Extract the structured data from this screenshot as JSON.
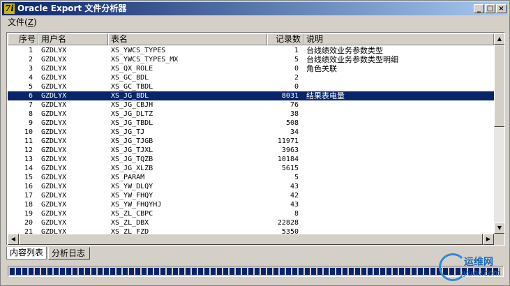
{
  "window": {
    "title": "Oracle Export 文件分析器",
    "icon": "app-icon",
    "icon_glyph": "7i",
    "buttons": [
      "minimize-icon",
      "maximize-icon",
      "close-icon"
    ],
    "button_glyphs": {
      "minimize": "_",
      "maximize": "□",
      "close": "×"
    }
  },
  "menu": {
    "file_label": "文件",
    "file_key": "Z"
  },
  "table": {
    "columns": [
      "序号",
      "用户名",
      "表名",
      "记录数",
      "说明"
    ],
    "selected_index": 5,
    "rows": [
      {
        "no": "1",
        "user": "GZDLYX",
        "table": "XS_YWCS_TYPES",
        "count": "1",
        "desc": "台线绩效业务参数类型"
      },
      {
        "no": "2",
        "user": "GZDLYX",
        "table": "XS_YWCS_TYPES_MX",
        "count": "5",
        "desc": "台线绩效业务参数类型明细"
      },
      {
        "no": "3",
        "user": "GZDLYX",
        "table": "XS_QX_ROLE",
        "count": "0",
        "desc": "角色关联"
      },
      {
        "no": "4",
        "user": "GZDLYX",
        "table": "XS_GC_BDL",
        "count": "2",
        "desc": ""
      },
      {
        "no": "5",
        "user": "GZDLYX",
        "table": "XS_GC_TBDL",
        "count": "0",
        "desc": ""
      },
      {
        "no": "6",
        "user": "GZDLYX",
        "table": "XS_JG_BDL",
        "count": "8031",
        "desc": "结果表电量"
      },
      {
        "no": "7",
        "user": "GZDLYX",
        "table": "XS_JG_CBJH",
        "count": "76",
        "desc": ""
      },
      {
        "no": "8",
        "user": "GZDLYX",
        "table": "XS_JG_DLTZ",
        "count": "38",
        "desc": ""
      },
      {
        "no": "9",
        "user": "GZDLYX",
        "table": "XS_JG_TBDL",
        "count": "508",
        "desc": ""
      },
      {
        "no": "10",
        "user": "GZDLYX",
        "table": "XS_JG_TJ",
        "count": "34",
        "desc": ""
      },
      {
        "no": "11",
        "user": "GZDLYX",
        "table": "XS_JG_TJGB",
        "count": "11971",
        "desc": ""
      },
      {
        "no": "12",
        "user": "GZDLYX",
        "table": "XS_JG_TJXL",
        "count": "3963",
        "desc": ""
      },
      {
        "no": "13",
        "user": "GZDLYX",
        "table": "XS_JG_TQZB",
        "count": "10184",
        "desc": ""
      },
      {
        "no": "14",
        "user": "GZDLYX",
        "table": "XS_JG_XLZB",
        "count": "5615",
        "desc": ""
      },
      {
        "no": "15",
        "user": "GZDLYX",
        "table": "XS_PARAM",
        "count": "5",
        "desc": ""
      },
      {
        "no": "16",
        "user": "GZDLYX",
        "table": "XS_YW_DLQY",
        "count": "43",
        "desc": ""
      },
      {
        "no": "17",
        "user": "GZDLYX",
        "table": "XS_YW_FHQY",
        "count": "42",
        "desc": ""
      },
      {
        "no": "18",
        "user": "GZDLYX",
        "table": "XS_YW_FHQYHJ",
        "count": "43",
        "desc": ""
      },
      {
        "no": "19",
        "user": "GZDLYX",
        "table": "XS_ZL_CBPC",
        "count": "8",
        "desc": ""
      },
      {
        "no": "20",
        "user": "GZDLYX",
        "table": "XS_ZL_DBX",
        "count": "22828",
        "desc": ""
      },
      {
        "no": "21",
        "user": "GZDLYX",
        "table": "XS_ZL_FZD",
        "count": "5350",
        "desc": ""
      }
    ]
  },
  "scrollbars": {
    "up_glyph": "▲",
    "down_glyph": "▼",
    "left_glyph": "◀",
    "right_glyph": "▶"
  },
  "tabs": [
    "内容列表",
    "分析日志"
  ],
  "progress": {
    "value": 1.0
  },
  "watermark": {
    "line1": "运维网",
    "line2": "iyunv.com"
  },
  "colors": {
    "selection": "#0a246a",
    "titlebar": "#0a246a",
    "progress": "#0a246a"
  }
}
